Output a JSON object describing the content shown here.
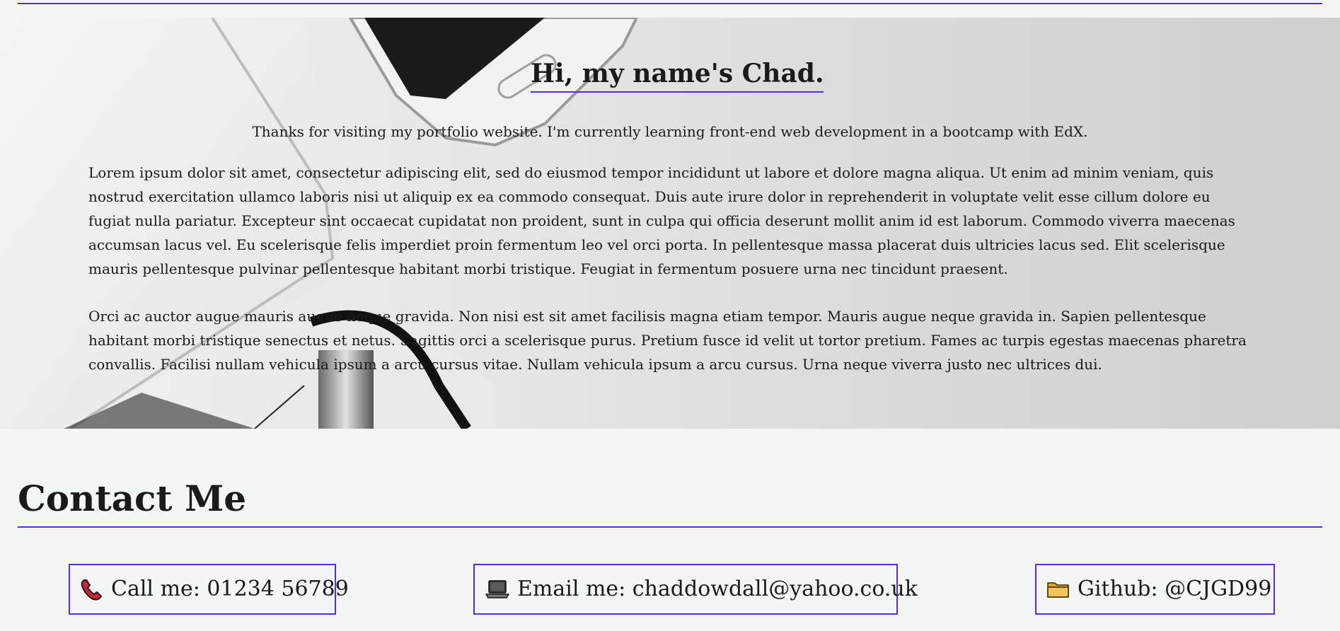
{
  "hero": {
    "title": "Hi, my name's Chad.",
    "intro": "Thanks for visiting my portfolio website. I'm currently learning front-end web development in a bootcamp with EdX.",
    "paragraphs": [
      "Lorem ipsum dolor sit amet, consectetur adipiscing elit, sed do eiusmod tempor incididunt ut labore et dolore magna aliqua. Ut enim ad minim veniam, quis nostrud exercitation ullamco laboris nisi ut aliquip ex ea commodo consequat. Duis aute irure dolor in reprehenderit in voluptate velit esse cillum dolore eu fugiat nulla pariatur. Excepteur sint occaecat cupidatat non proident, sunt in culpa qui officia deserunt mollit anim id est laborum. Commodo viverra maecenas accumsan lacus vel. Eu scelerisque felis imperdiet proin fermentum leo vel orci porta. In pellentesque massa placerat duis ultricies lacus sed. Elit scelerisque mauris pellentesque pulvinar pellentesque habitant morbi tristique. Feugiat in fermentum posuere urna nec tincidunt praesent.",
      "Orci ac auctor augue mauris augue neque gravida. Non nisi est sit amet facilisis magna etiam tempor. Mauris augue neque gravida in. Sapien pellentesque habitant morbi tristique senectus et netus. Sagittis orci a scelerisque purus. Pretium fusce id velit ut tortor pretium. Fames ac turpis egestas maecenas pharetra convallis. Facilisi nullam vehicula ipsum a arcu cursus vitae. Nullam vehicula ipsum a arcu cursus. Urna neque viverra justo nec ultrices dui."
    ]
  },
  "contact": {
    "title": "Contact Me",
    "items": [
      {
        "icon": "phone-icon",
        "label": "Call me: 01234 56789"
      },
      {
        "icon": "laptop-icon",
        "label": "Email me: chaddowdall@yahoo.co.uk"
      },
      {
        "icon": "folder-icon",
        "label": "Github: @CJGD99"
      }
    ]
  },
  "colors": {
    "accent": "#5a2bd6",
    "background": "#f4f5f5",
    "text": "#1a1a1a"
  }
}
